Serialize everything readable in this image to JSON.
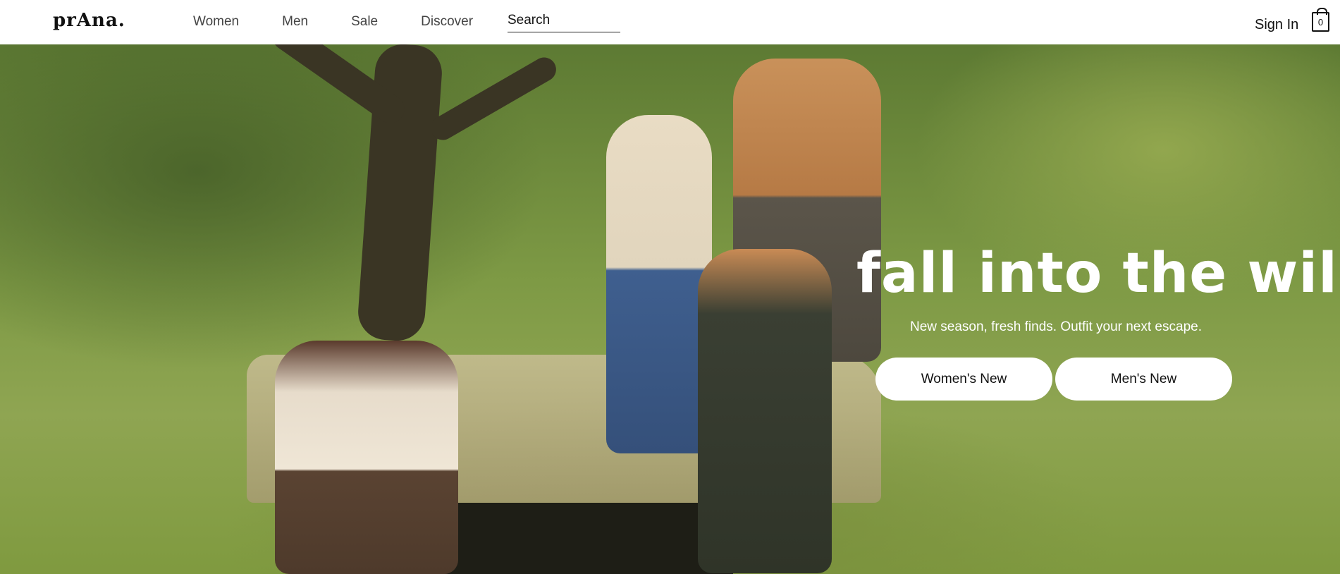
{
  "header": {
    "logo": "prAna.",
    "nav": [
      "Women",
      "Men",
      "Sale",
      "Discover"
    ],
    "search_placeholder": "Search",
    "sign_in": "Sign In",
    "cart_count": "0"
  },
  "hero": {
    "title": "fall into the wild",
    "subtitle": "New season, fresh finds. Outfit your next escape.",
    "buttons": [
      "Women's New",
      "Men's New"
    ]
  },
  "colors": {
    "header_bg": "#ffffff",
    "text": "#111111",
    "hero_text": "#ffffff",
    "button_bg": "#ffffff"
  }
}
